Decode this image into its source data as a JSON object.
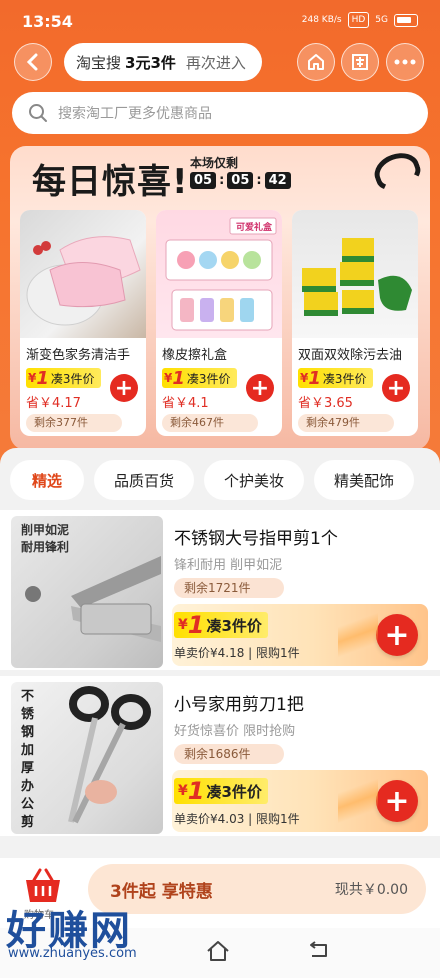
{
  "status_bar": {
    "time": "13:54",
    "net_speed": "248 KB/s",
    "hd": "HD",
    "signal": "5G"
  },
  "nav": {
    "search_brand": "淘宝搜",
    "search_promo": "3元3件",
    "search_again": "再次进入"
  },
  "search": {
    "placeholder": "搜索淘工厂更多优惠商品"
  },
  "surprise": {
    "title": "每日惊喜!",
    "timer_label": "本场仅剩",
    "timer": [
      "05",
      "05",
      "42"
    ],
    "products": [
      {
        "name": "渐变色家务清洁手",
        "tag_symbol": "¥",
        "tag_one": "1",
        "tag_text": "凑3件价",
        "save": "省￥4.17",
        "remain": "剩余377件"
      },
      {
        "name": "橡皮擦礼盒",
        "tag_symbol": "¥",
        "tag_one": "1",
        "tag_text": "凑3件价",
        "save": "省￥4.1",
        "remain": "剩余467件",
        "img_badge": "可爱礼盒"
      },
      {
        "name": "双面双效除污去油",
        "tag_symbol": "¥",
        "tag_one": "1",
        "tag_text": "凑3件价",
        "save": "省￥3.65",
        "remain": "剩余479件"
      }
    ]
  },
  "tabs": [
    "精选",
    "品质百货",
    "个护美妆",
    "精美配饰"
  ],
  "items": [
    {
      "title": "不锈钢大号指甲剪1个",
      "subtitle": "锋利耐用 削甲如泥",
      "remain": "剩余1721件",
      "tag_symbol": "¥",
      "tag_one": "1",
      "tag_text": "凑3件价",
      "footer": "单卖价¥4.18 | 限购1件",
      "img_text": "削甲如泥\n耐用锋利"
    },
    {
      "title": "小号家用剪刀1把",
      "subtitle": "好货惊喜价 限时抢购",
      "remain": "剩余1686件",
      "tag_symbol": "¥",
      "tag_one": "1",
      "tag_text": "凑3件价",
      "footer": "单卖价¥4.03 | 限购1件",
      "img_text": "不锈钢加厚办公剪"
    }
  ],
  "bottom": {
    "cart_label": "购物车",
    "checkout_left": "3件起 享特惠",
    "checkout_right": "现共￥0.00"
  },
  "watermark": {
    "text": "好赚网",
    "url": "www.zhuanyes.com"
  },
  "colors": {
    "primary_orange": "#f26a2c",
    "price_red": "#e02e24",
    "tag_yellow": "#ffe000"
  }
}
